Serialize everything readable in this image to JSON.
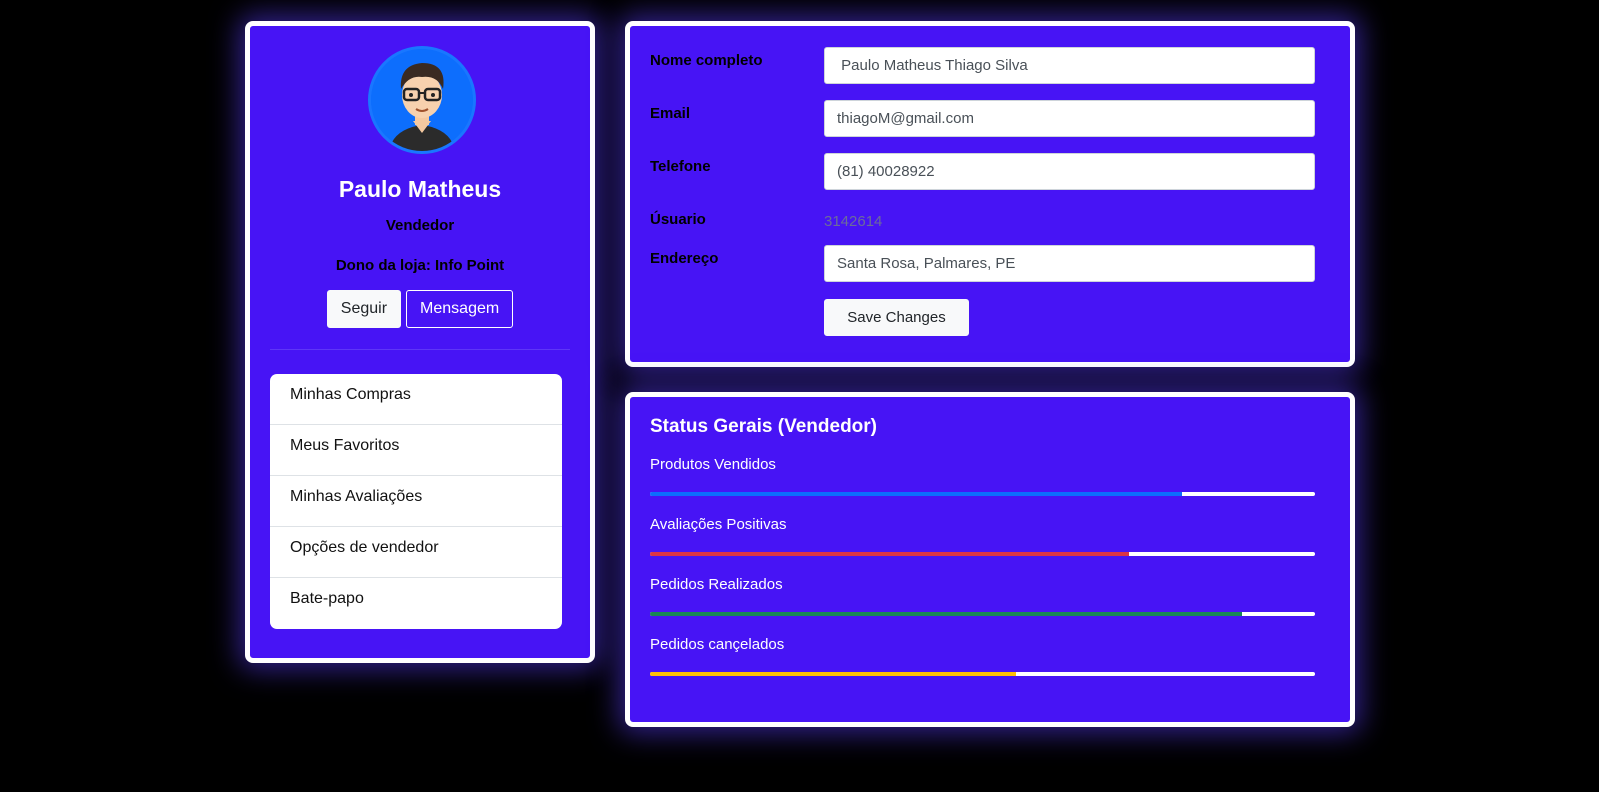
{
  "profile": {
    "name": "Paulo Matheus",
    "role": "Vendedor",
    "store": "Dono da loja: Info Point",
    "follow_label": "Seguir",
    "message_label": "Mensagem",
    "menu": [
      {
        "label": "Minhas Compras"
      },
      {
        "label": "Meus Favoritos"
      },
      {
        "label": "Minhas Avaliações"
      },
      {
        "label": "Opções de vendedor"
      },
      {
        "label": "Bate-papo"
      }
    ]
  },
  "details": {
    "fields": [
      {
        "label": "Nome completo",
        "value": " Paulo Matheus Thiago Silva"
      },
      {
        "label": "Email",
        "value": "thiagoM@gmail.com"
      },
      {
        "label": "Telefone",
        "value": "(81) 40028922"
      },
      {
        "label": "Úsuario",
        "value": "3142614"
      },
      {
        "label": "Endereço",
        "value": "Santa Rosa, Palmares, PE"
      }
    ],
    "save_label": "Save Changes"
  },
  "stats": {
    "title": "Status Gerais (Vendedor)",
    "items": [
      {
        "label": "Produtos Vendidos",
        "percent": 80,
        "color": "#0d6efd"
      },
      {
        "label": "Avaliações Positivas",
        "percent": 72,
        "color": "#dc3545"
      },
      {
        "label": "Pedidos Realizados",
        "percent": 89,
        "color": "#198754"
      },
      {
        "label": "Pedidos cançelados",
        "percent": 55,
        "color": "#ffc107"
      }
    ]
  }
}
